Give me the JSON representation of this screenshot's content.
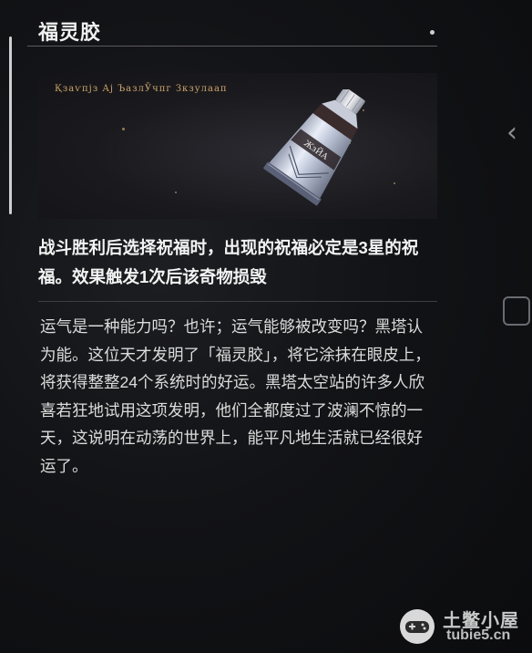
{
  "item": {
    "name": "福灵胶",
    "image_caption": "Қзаѵпјз Ај ЪазлӮчпг Зкзулаап",
    "tube_label": "ЖзЙА",
    "effect": "战斗胜利后选择祝福时，出现的祝福必定是3星的祝福。效果触发1次后该奇物损毁",
    "lore": "运气是一种能力吗？也许；运气能够被改变吗？黑塔认为能。这位天才发明了「福灵胶」，将它涂抹在眼皮上，将获得整整24个系统时的好运。黑塔太空站的许多人欣喜若狂地试用这项发明，他们全都度过了波澜不惊的一天，这说明在动荡的世界上，能平凡地生活就已经很好运了。"
  },
  "watermark": {
    "name": "土鳖小屋",
    "domain": "tubie5.cn"
  },
  "icons": {
    "nav_right": "chevron-right-icon",
    "side_button": "square-button-icon",
    "watermark_logo": "gamepad-logo"
  },
  "colors": {
    "background": "#121316",
    "text": "#f3f3f3",
    "accent_gold": "#cfa56a"
  }
}
